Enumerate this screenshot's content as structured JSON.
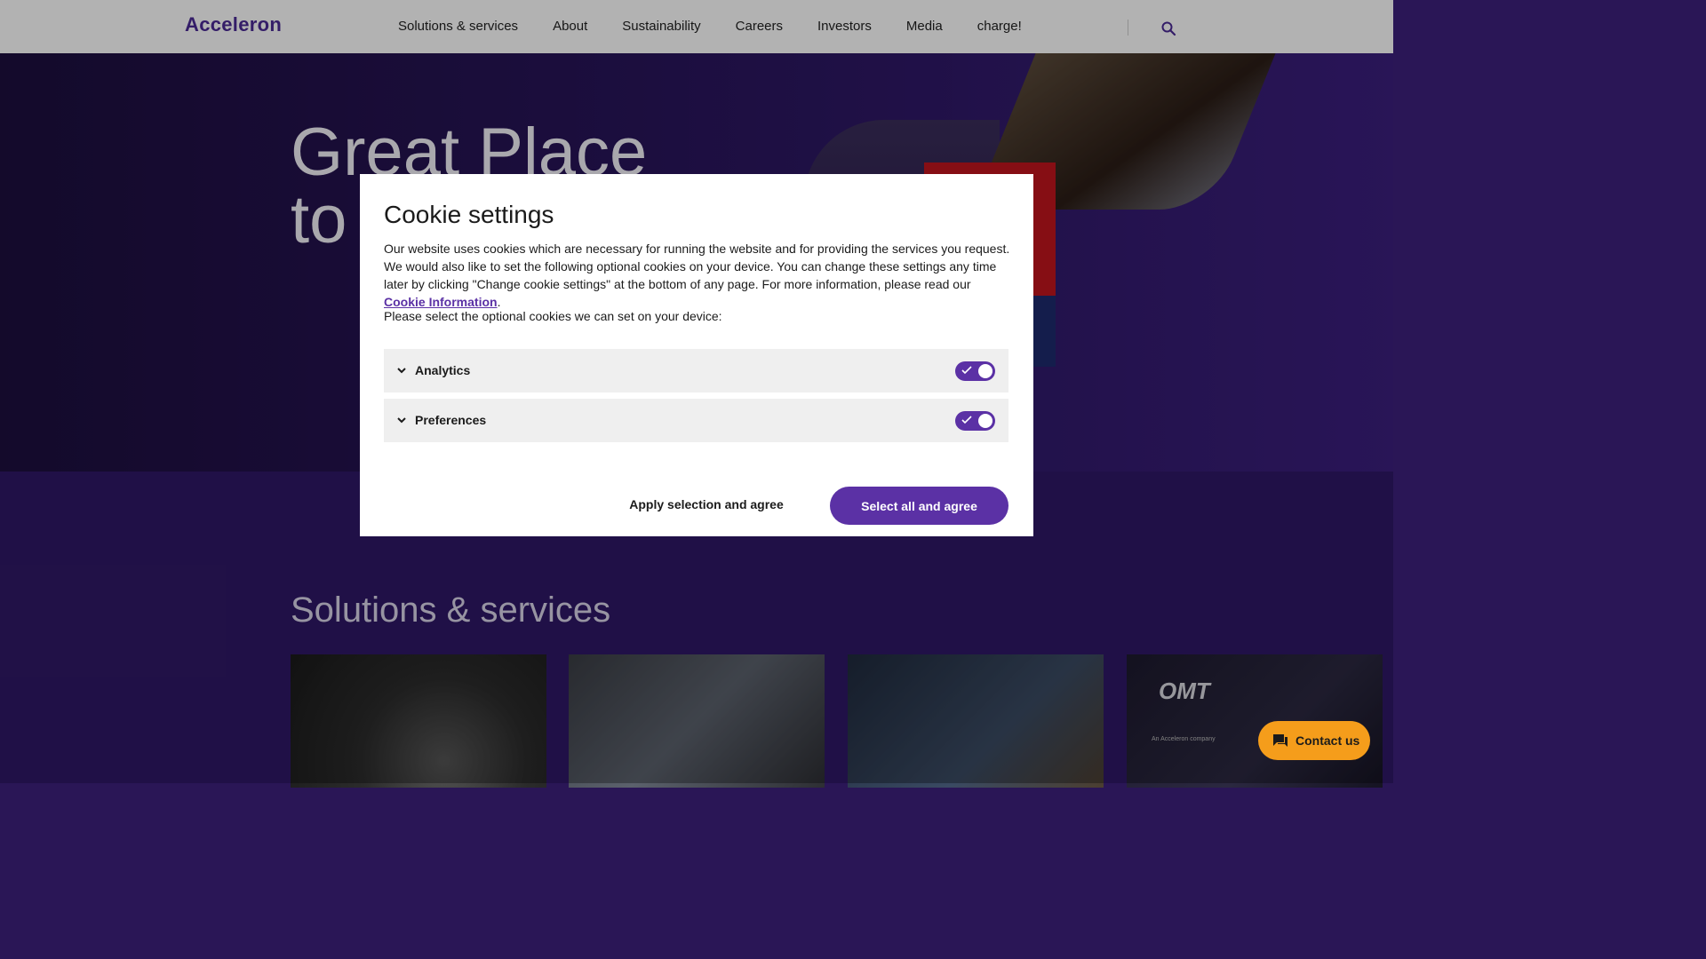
{
  "header": {
    "logo": "Acceleron",
    "nav": [
      "Solutions & services",
      "About",
      "Sustainability",
      "Careers",
      "Investors",
      "Media",
      "charge!"
    ],
    "search_icon": "search-icon"
  },
  "hero": {
    "title_line1": "Great Place",
    "title_line2": "to"
  },
  "solutions": {
    "title": "Solutions & services",
    "omt_logo": "OMT",
    "omt_sub": "An Acceleron company"
  },
  "contact": {
    "label": "Contact us",
    "icon": "chat-icon"
  },
  "cookie_modal": {
    "title": "Cookie settings",
    "text_before_link": "Our website uses cookies which are necessary for running the website and for providing the services you request. We would also like to set the following optional cookies on your device. You can change these settings any time later by clicking \"Change cookie settings\" at the bottom of any page. For more information, please read our ",
    "link_text": "Cookie Information",
    "text_after_link": ".",
    "prompt": "Please select the optional cookies we can set on your device:",
    "options": [
      {
        "label": "Analytics",
        "enabled": true
      },
      {
        "label": "Preferences",
        "enabled": true
      }
    ],
    "apply_label": "Apply selection and agree",
    "select_all_label": "Select all and agree"
  },
  "colors": {
    "accent": "#5b31a5",
    "contact": "#f59d1b"
  }
}
